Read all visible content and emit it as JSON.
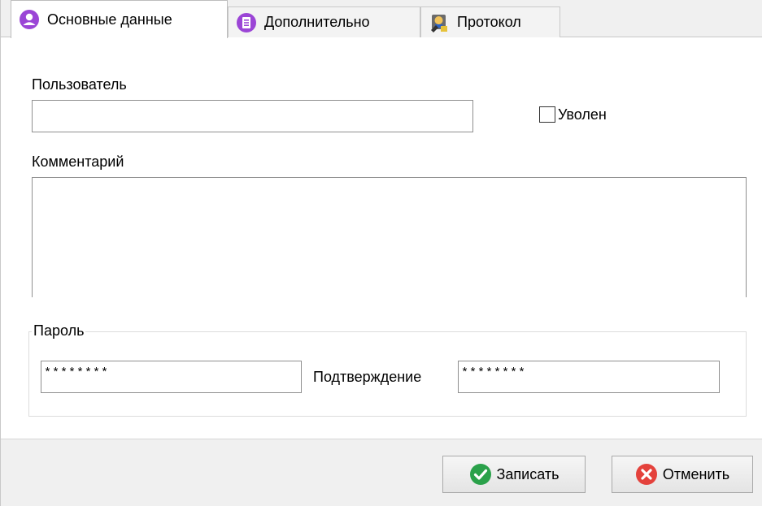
{
  "tabs": [
    {
      "label": "Основные данные",
      "icon": "user-circle-icon",
      "active": true
    },
    {
      "label": "Дополнительно",
      "icon": "document-list-icon",
      "active": false
    },
    {
      "label": "Протокол",
      "icon": "protocol-icon",
      "active": false
    }
  ],
  "form": {
    "user_label": "Пользователь",
    "user_value": "",
    "fired_label": "Уволен",
    "fired_checked": false,
    "comment_label": "Комментарий",
    "comment_value": "",
    "password_group_title": "Пароль",
    "password_value": "********",
    "confirm_label": "Подтверждение",
    "confirm_value": "********"
  },
  "buttons": {
    "save_label": "Записать",
    "cancel_label": "Отменить"
  },
  "colors": {
    "user_icon": "#9b45d6",
    "save_icon": "#2aa14a",
    "cancel_icon": "#e4423c"
  }
}
